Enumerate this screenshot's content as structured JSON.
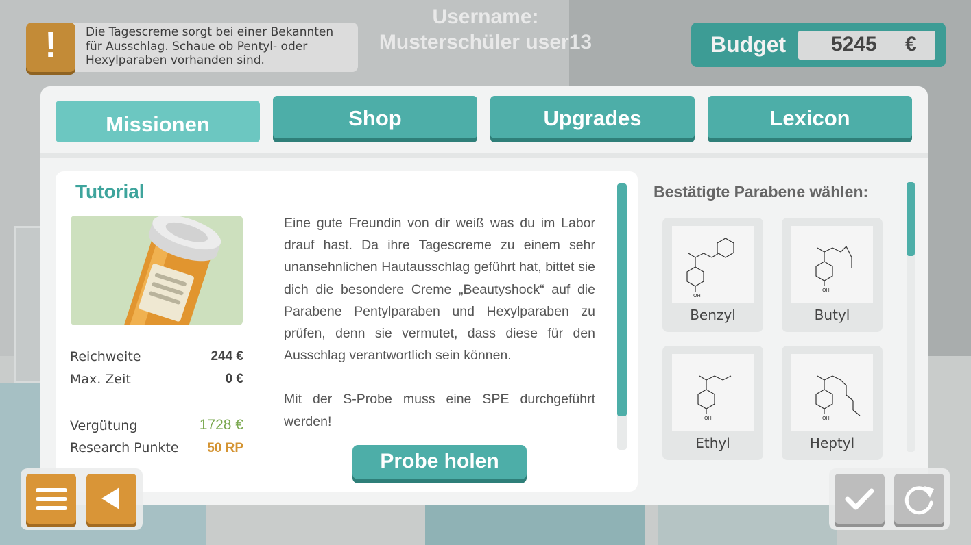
{
  "hint": {
    "icon": "exclamation-icon",
    "text": "Die Tagescreme sorgt bei einer Bekannten für Ausschlag. Schaue ob Pentyl- oder Hexylparaben vorhanden sind."
  },
  "user": {
    "line1": "Username:",
    "line2": "Musterschüler user13"
  },
  "budget": {
    "label": "Budget",
    "value": "5245",
    "currency": "€"
  },
  "tabs": [
    {
      "label": "Missionen",
      "active": true
    },
    {
      "label": "Shop",
      "active": false
    },
    {
      "label": "Upgrades",
      "active": false
    },
    {
      "label": "Lexicon",
      "active": false
    }
  ],
  "mission": {
    "title": "Tutorial",
    "image_icon": "pill-bottle-icon",
    "stats": [
      {
        "label": "Reichweite",
        "value": "244 €",
        "color": "#444444"
      },
      {
        "label": "Max. Zeit",
        "value": "0 €",
        "color": "#444444"
      },
      {
        "label": "Vergütung",
        "value": "1728 €",
        "color": "#7aa84f"
      },
      {
        "label": "Research Punkte",
        "value": "50 RP",
        "color": "#d49433"
      }
    ],
    "description": [
      "Eine gute Freundin von dir weiß was du im Labor drauf hast. Da ihre Tagescreme zu einem sehr unansehnlichen Hautausschlag geführt hat, bittet sie dich die besondere Creme „Beautyshock“ auf die Parabene Pentylparaben und Hexylparaben zu prüfen, denn sie vermutet, dass diese für den Ausschlag verantwortlich sein können.",
      "Mit der S-Probe muss eine SPE durchgeführt werden!"
    ],
    "action_label": "Probe holen"
  },
  "parabens": {
    "title": "Bestätigte Parabene wählen:",
    "items": [
      {
        "label": "Benzyl",
        "icon": "benzylparaben-structure-icon"
      },
      {
        "label": "Butyl",
        "icon": "butylparaben-structure-icon"
      },
      {
        "label": "Ethyl",
        "icon": "ethylparaben-structure-icon"
      },
      {
        "label": "Heptyl",
        "icon": "heptylparaben-structure-icon"
      }
    ]
  },
  "controls": {
    "menu_icon": "menu-icon",
    "back_icon": "back-arrow-icon",
    "confirm_icon": "checkmark-icon",
    "reset_icon": "reload-icon"
  },
  "colors": {
    "teal": "#4daea8",
    "teal_dark": "#2f7f79",
    "teal_light": "#6cc7c1",
    "orange": "#d99537",
    "grey_button": "#bdbdbd"
  }
}
